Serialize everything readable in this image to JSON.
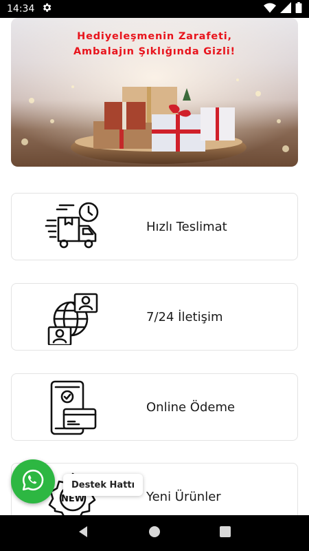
{
  "status_bar": {
    "time": "14:34"
  },
  "banner": {
    "title_line1": "Hediyeleşmenin Zarafeti,",
    "title_line2": "Ambalajın Şıklığında Gizli!"
  },
  "cards": [
    {
      "label": "Hızlı Teslimat",
      "icon": "delivery-truck-icon"
    },
    {
      "label": "7/24 İletişim",
      "icon": "global-contact-icon"
    },
    {
      "label": "Online Ödeme",
      "icon": "mobile-payment-icon"
    },
    {
      "label": "Yeni Ürünler",
      "icon": "new-badge-icon"
    }
  ],
  "support": {
    "label": "Destek Hattı"
  },
  "colors": {
    "banner_title": "#e8141c",
    "whatsapp": "#2db742"
  }
}
